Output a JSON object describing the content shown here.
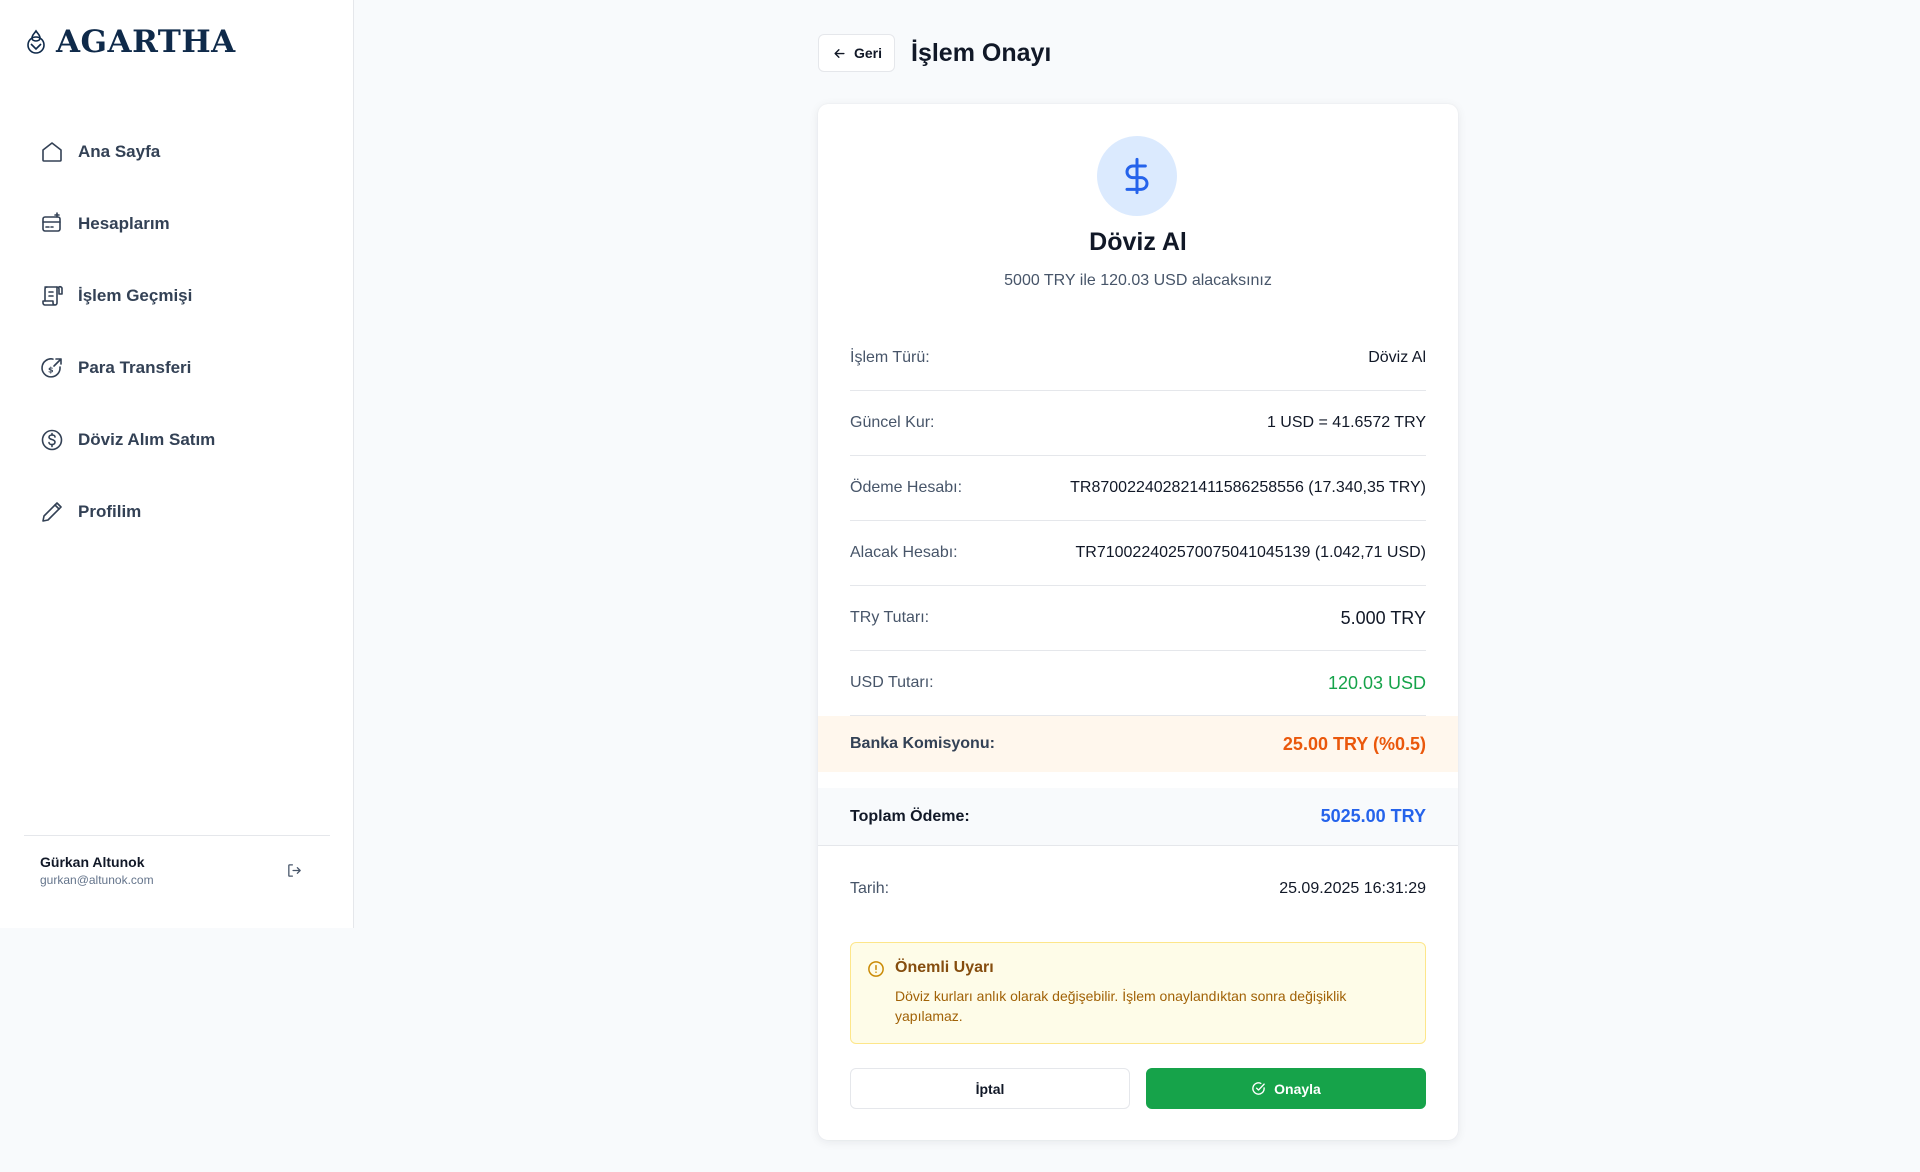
{
  "brand": {
    "name": "AGARTHA"
  },
  "sidebar": {
    "items": [
      {
        "label": "Ana Sayfa",
        "icon": "home-icon"
      },
      {
        "label": "Hesaplarım",
        "icon": "wallet-icon"
      },
      {
        "label": "İşlem Geçmişi",
        "icon": "receipt-icon"
      },
      {
        "label": "Para Transferi",
        "icon": "transfer-icon"
      },
      {
        "label": "Döviz Alım Satım",
        "icon": "dollar-circle-icon"
      },
      {
        "label": "Profilim",
        "icon": "pencil-icon"
      }
    ],
    "user": {
      "name": "Gürkan Altunok",
      "email": "gurkan@altunok.com"
    }
  },
  "header": {
    "back_label": "Geri",
    "title": "İşlem Onayı"
  },
  "card": {
    "title": "Döviz Al",
    "subtitle": "5000 TRY ile 120.03 USD alacaksınız",
    "rows": [
      {
        "label": "İşlem Türü:",
        "value": "Döviz Al"
      },
      {
        "label": "Güncel Kur:",
        "value": "1 USD = 41.6572 TRY"
      },
      {
        "label": "Ödeme Hesabı:",
        "value": "TR870022402821411586258556 (17.340,35 TRY)"
      },
      {
        "label": "Alacak Hesabı:",
        "value": "TR710022402570075041045139 (1.042,71 USD)"
      },
      {
        "label": "TRy Tutarı:",
        "value": "5.000 TRY"
      },
      {
        "label": "USD Tutarı:",
        "value": "120.03 USD"
      }
    ],
    "fee": {
      "label": "Banka Komisyonu:",
      "value": "25.00 TRY (%0.5)"
    },
    "total": {
      "label": "Toplam Ödeme:",
      "value": "5025.00 TRY"
    },
    "date": {
      "label": "Tarih:",
      "value": "25.09.2025 16:31:29"
    },
    "warning": {
      "title": "Önemli Uyarı",
      "text": "Döviz kurları anlık olarak değişebilir. İşlem onaylandıktan sonra değişiklik yapılamaz."
    },
    "actions": {
      "cancel": "İptal",
      "confirm": "Onayla"
    }
  },
  "colors": {
    "accent_blue": "#2563eb",
    "success_green": "#16a34a",
    "fee_orange": "#ea580c",
    "brand_navy": "#0f2a4a"
  }
}
